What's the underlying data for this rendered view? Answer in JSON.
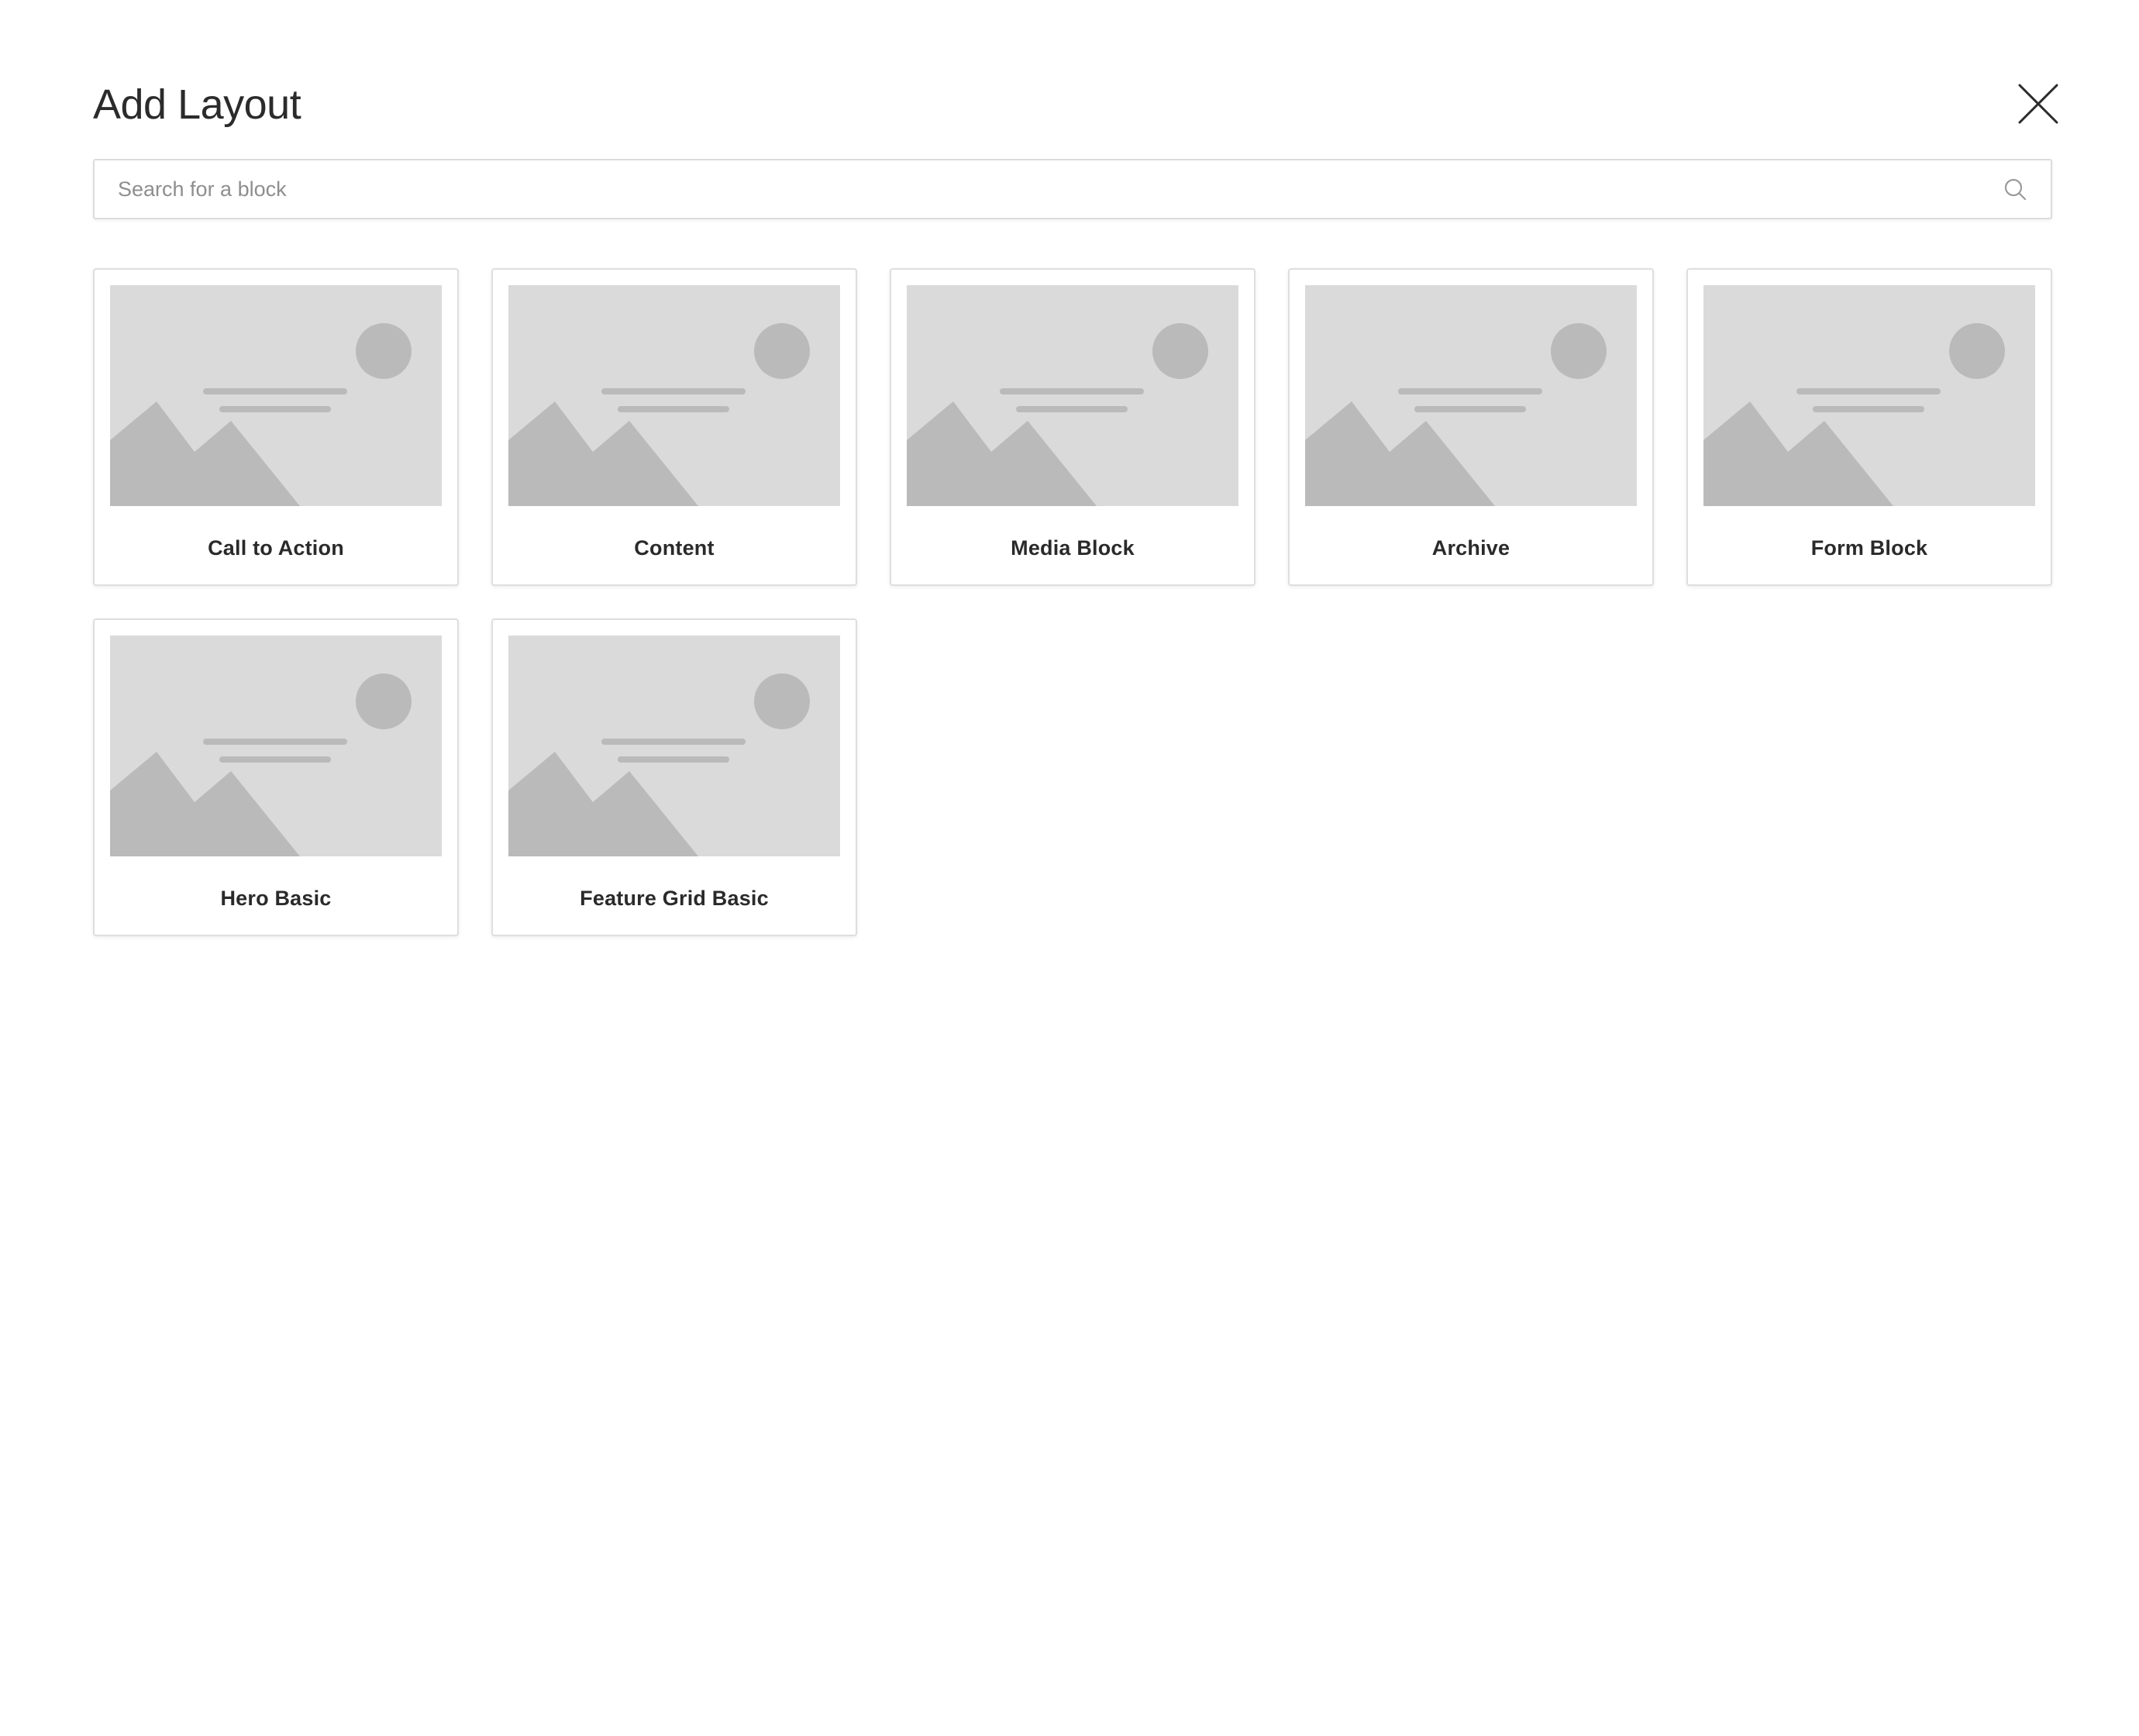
{
  "modal": {
    "title": "Add Layout",
    "close_icon": "close-icon"
  },
  "search": {
    "placeholder": "Search for a block",
    "value": "",
    "icon": "search-icon"
  },
  "blocks": [
    {
      "label": "Call to Action",
      "thumbnail_icon": "image-placeholder-icon"
    },
    {
      "label": "Content",
      "thumbnail_icon": "image-placeholder-icon"
    },
    {
      "label": "Media Block",
      "thumbnail_icon": "image-placeholder-icon"
    },
    {
      "label": "Archive",
      "thumbnail_icon": "image-placeholder-icon"
    },
    {
      "label": "Form Block",
      "thumbnail_icon": "image-placeholder-icon"
    },
    {
      "label": "Hero Basic",
      "thumbnail_icon": "image-placeholder-icon"
    },
    {
      "label": "Feature Grid Basic",
      "thumbnail_icon": "image-placeholder-icon"
    }
  ],
  "colors": {
    "placeholder_background": "#dadada",
    "placeholder_shape": "#bababa",
    "text": "#2a2a2a",
    "border": "#dedede"
  }
}
